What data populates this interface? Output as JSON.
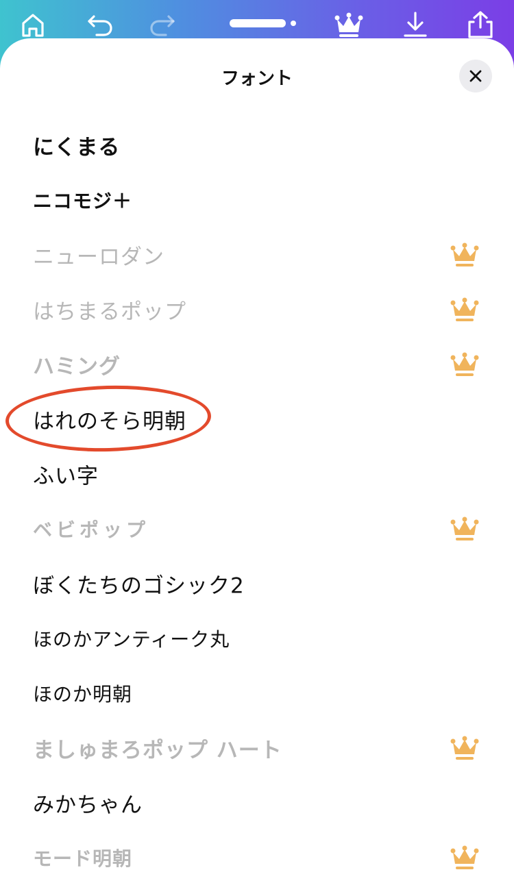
{
  "toolbar": {
    "home_icon": "home-icon",
    "undo_icon": "undo-icon",
    "redo_icon": "redo-icon",
    "premium_icon": "crown-icon",
    "download_icon": "download-icon",
    "share_icon": "share-icon"
  },
  "sheet": {
    "title": "フォント",
    "close_icon": "close-icon"
  },
  "colors": {
    "gradient_start": "#3fc3cf",
    "gradient_end": "#7b3ee6",
    "crown": "#f0b45c",
    "locked_text": "#b7b7b7",
    "highlight": "#e34a2c"
  },
  "fonts": [
    {
      "name": "にくまる",
      "premium": false
    },
    {
      "name": "ニコモジ＋",
      "premium": false
    },
    {
      "name": "ニューロダン",
      "premium": true
    },
    {
      "name": "はちまるポップ",
      "premium": true
    },
    {
      "name": "ハミング",
      "premium": true
    },
    {
      "name": "はれのそら明朝",
      "premium": false,
      "highlighted": true
    },
    {
      "name": "ふい字",
      "premium": false
    },
    {
      "name": "ベビポップ",
      "premium": true
    },
    {
      "name": "ぼくたちのゴシック2",
      "premium": false
    },
    {
      "name": "ほのかアンティーク丸",
      "premium": false
    },
    {
      "name": "ほのか明朝",
      "premium": false
    },
    {
      "name": "ましゅまろポップ ハート",
      "premium": true
    },
    {
      "name": "みかちゃん",
      "premium": false
    },
    {
      "name": "モード明朝",
      "premium": true
    }
  ]
}
